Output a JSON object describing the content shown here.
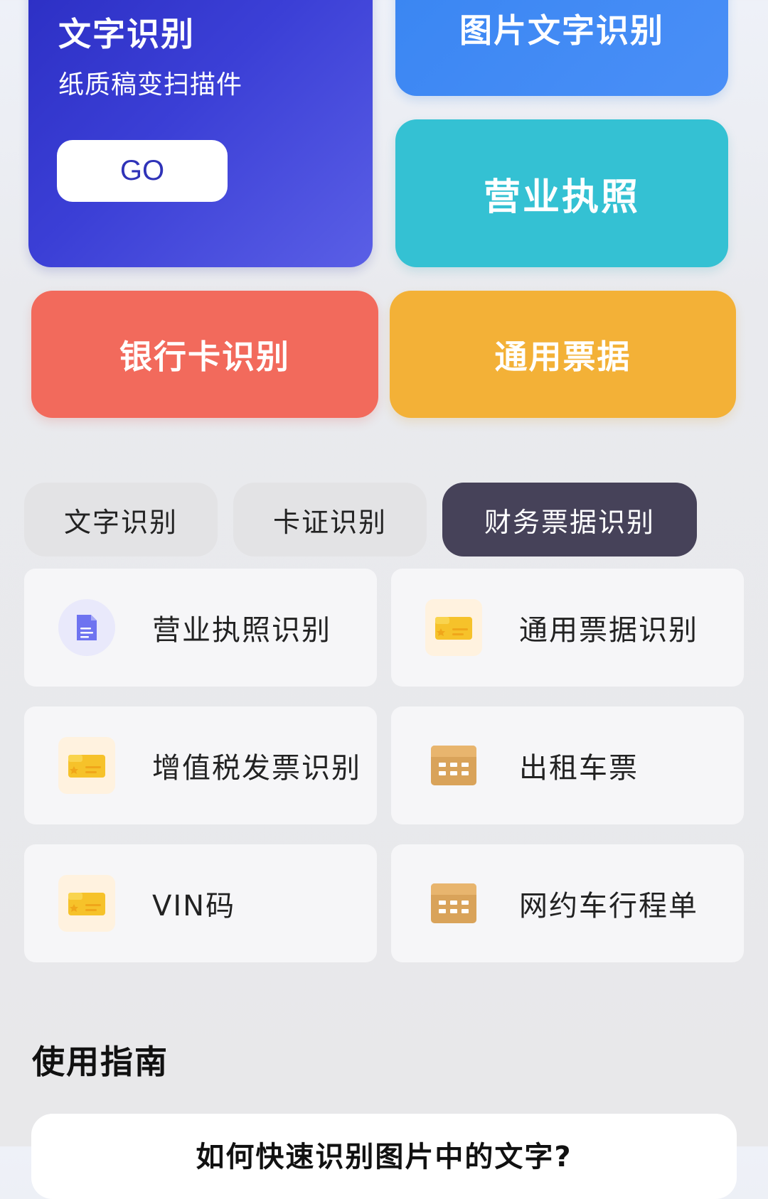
{
  "hero": {
    "text_card": {
      "title": "文字识别",
      "subtitle": "纸质稿变扫描件",
      "go_label": "GO"
    },
    "image_text_card": {
      "label": "图片文字识别"
    },
    "license_card": {
      "label": "营业执照"
    },
    "bank_card": {
      "label": "银行卡识别"
    },
    "bill_card": {
      "label": "通用票据"
    }
  },
  "tabs": [
    {
      "label": "文字识别",
      "active": false
    },
    {
      "label": "卡证识别",
      "active": false
    },
    {
      "label": "财务票据识别",
      "active": true
    }
  ],
  "items": [
    {
      "label": "营业执照识别",
      "icon": "document-icon"
    },
    {
      "label": "通用票据识别",
      "icon": "ticket-icon"
    },
    {
      "label": "增值税发票识别",
      "icon": "ticket-icon"
    },
    {
      "label": "出租车票",
      "icon": "calendar-icon"
    },
    {
      "label": "VIN码",
      "icon": "ticket-icon"
    },
    {
      "label": "网约车行程单",
      "icon": "calendar-icon"
    }
  ],
  "guide": {
    "title": "使用指南",
    "first_item": "如何快速识别图片中的文字?"
  },
  "colors": {
    "text_card": "#3b3fd6",
    "image_text_card": "#4a8ff7",
    "license_card": "#34c1d3",
    "bank_card": "#f26a5c",
    "bill_card": "#f3b137",
    "active_tab": "#464259"
  }
}
